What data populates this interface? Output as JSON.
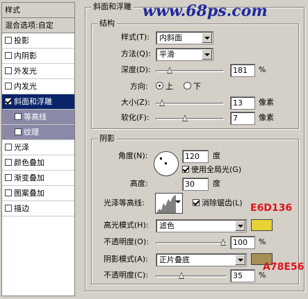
{
  "watermark": "www.68ps.com",
  "sidebar": {
    "header": "样式",
    "blend_options": "混合选项:自定",
    "items": [
      {
        "label": "投影",
        "checked": false
      },
      {
        "label": "内阴影",
        "checked": false
      },
      {
        "label": "外发光",
        "checked": false
      },
      {
        "label": "内发光",
        "checked": false
      },
      {
        "label": "斜面和浮雕",
        "checked": true,
        "selected": true
      },
      {
        "label": "等高线",
        "checked": false,
        "sub": true
      },
      {
        "label": "纹理",
        "checked": false,
        "sub": true
      },
      {
        "label": "光泽",
        "checked": false
      },
      {
        "label": "颜色叠加",
        "checked": false
      },
      {
        "label": "渐变叠加",
        "checked": false
      },
      {
        "label": "图案叠加",
        "checked": false
      },
      {
        "label": "描边",
        "checked": false
      }
    ]
  },
  "bevel": {
    "title": "斜面和浮雕",
    "structure": {
      "title": "结构",
      "style_label": "样式(T):",
      "style_value": "内斜面",
      "technique_label": "方法(Q):",
      "technique_value": "平滑",
      "depth_label": "深度(D):",
      "depth_value": "181",
      "depth_slider_fraction": 0.18,
      "depth_unit": "%",
      "direction_label": "方向:",
      "direction_up": "上",
      "direction_down": "下",
      "size_label": "大小(Z):",
      "size_value": "13",
      "size_slider_fraction": 0.06,
      "size_unit": "像素",
      "soften_label": "软化(F):",
      "soften_value": "7",
      "soften_slider_fraction": 0.43,
      "soften_unit": "像素"
    },
    "shading": {
      "title": "阴影",
      "angle_label": "角度(N):",
      "angle_value": "120",
      "angle_unit": "度",
      "global_light_label": "使用全局光(G)",
      "global_light_checked": true,
      "altitude_label": "高度:",
      "altitude_value": "30",
      "altitude_unit": "度",
      "gloss_label": "光泽等高线:",
      "antialias_label": "消除锯齿(L)",
      "antialias_checked": true,
      "highlight_label": "高光模式(H):",
      "highlight_value": "滤色",
      "highlight_color": "#e6d136",
      "highlight_color_note": "E6D136",
      "highlight_opacity_label": "不透明度(O):",
      "highlight_opacity_value": "100",
      "highlight_opacity_fraction": 1.0,
      "highlight_opacity_unit": "%",
      "shadow_label": "阴影模式(A):",
      "shadow_value": "正片叠底",
      "shadow_color": "#a78e56",
      "shadow_color_note": "A78E56",
      "shadow_opacity_label": "不透明度(C):",
      "shadow_opacity_value": "35",
      "shadow_opacity_fraction": 0.35,
      "shadow_opacity_unit": "%"
    }
  }
}
